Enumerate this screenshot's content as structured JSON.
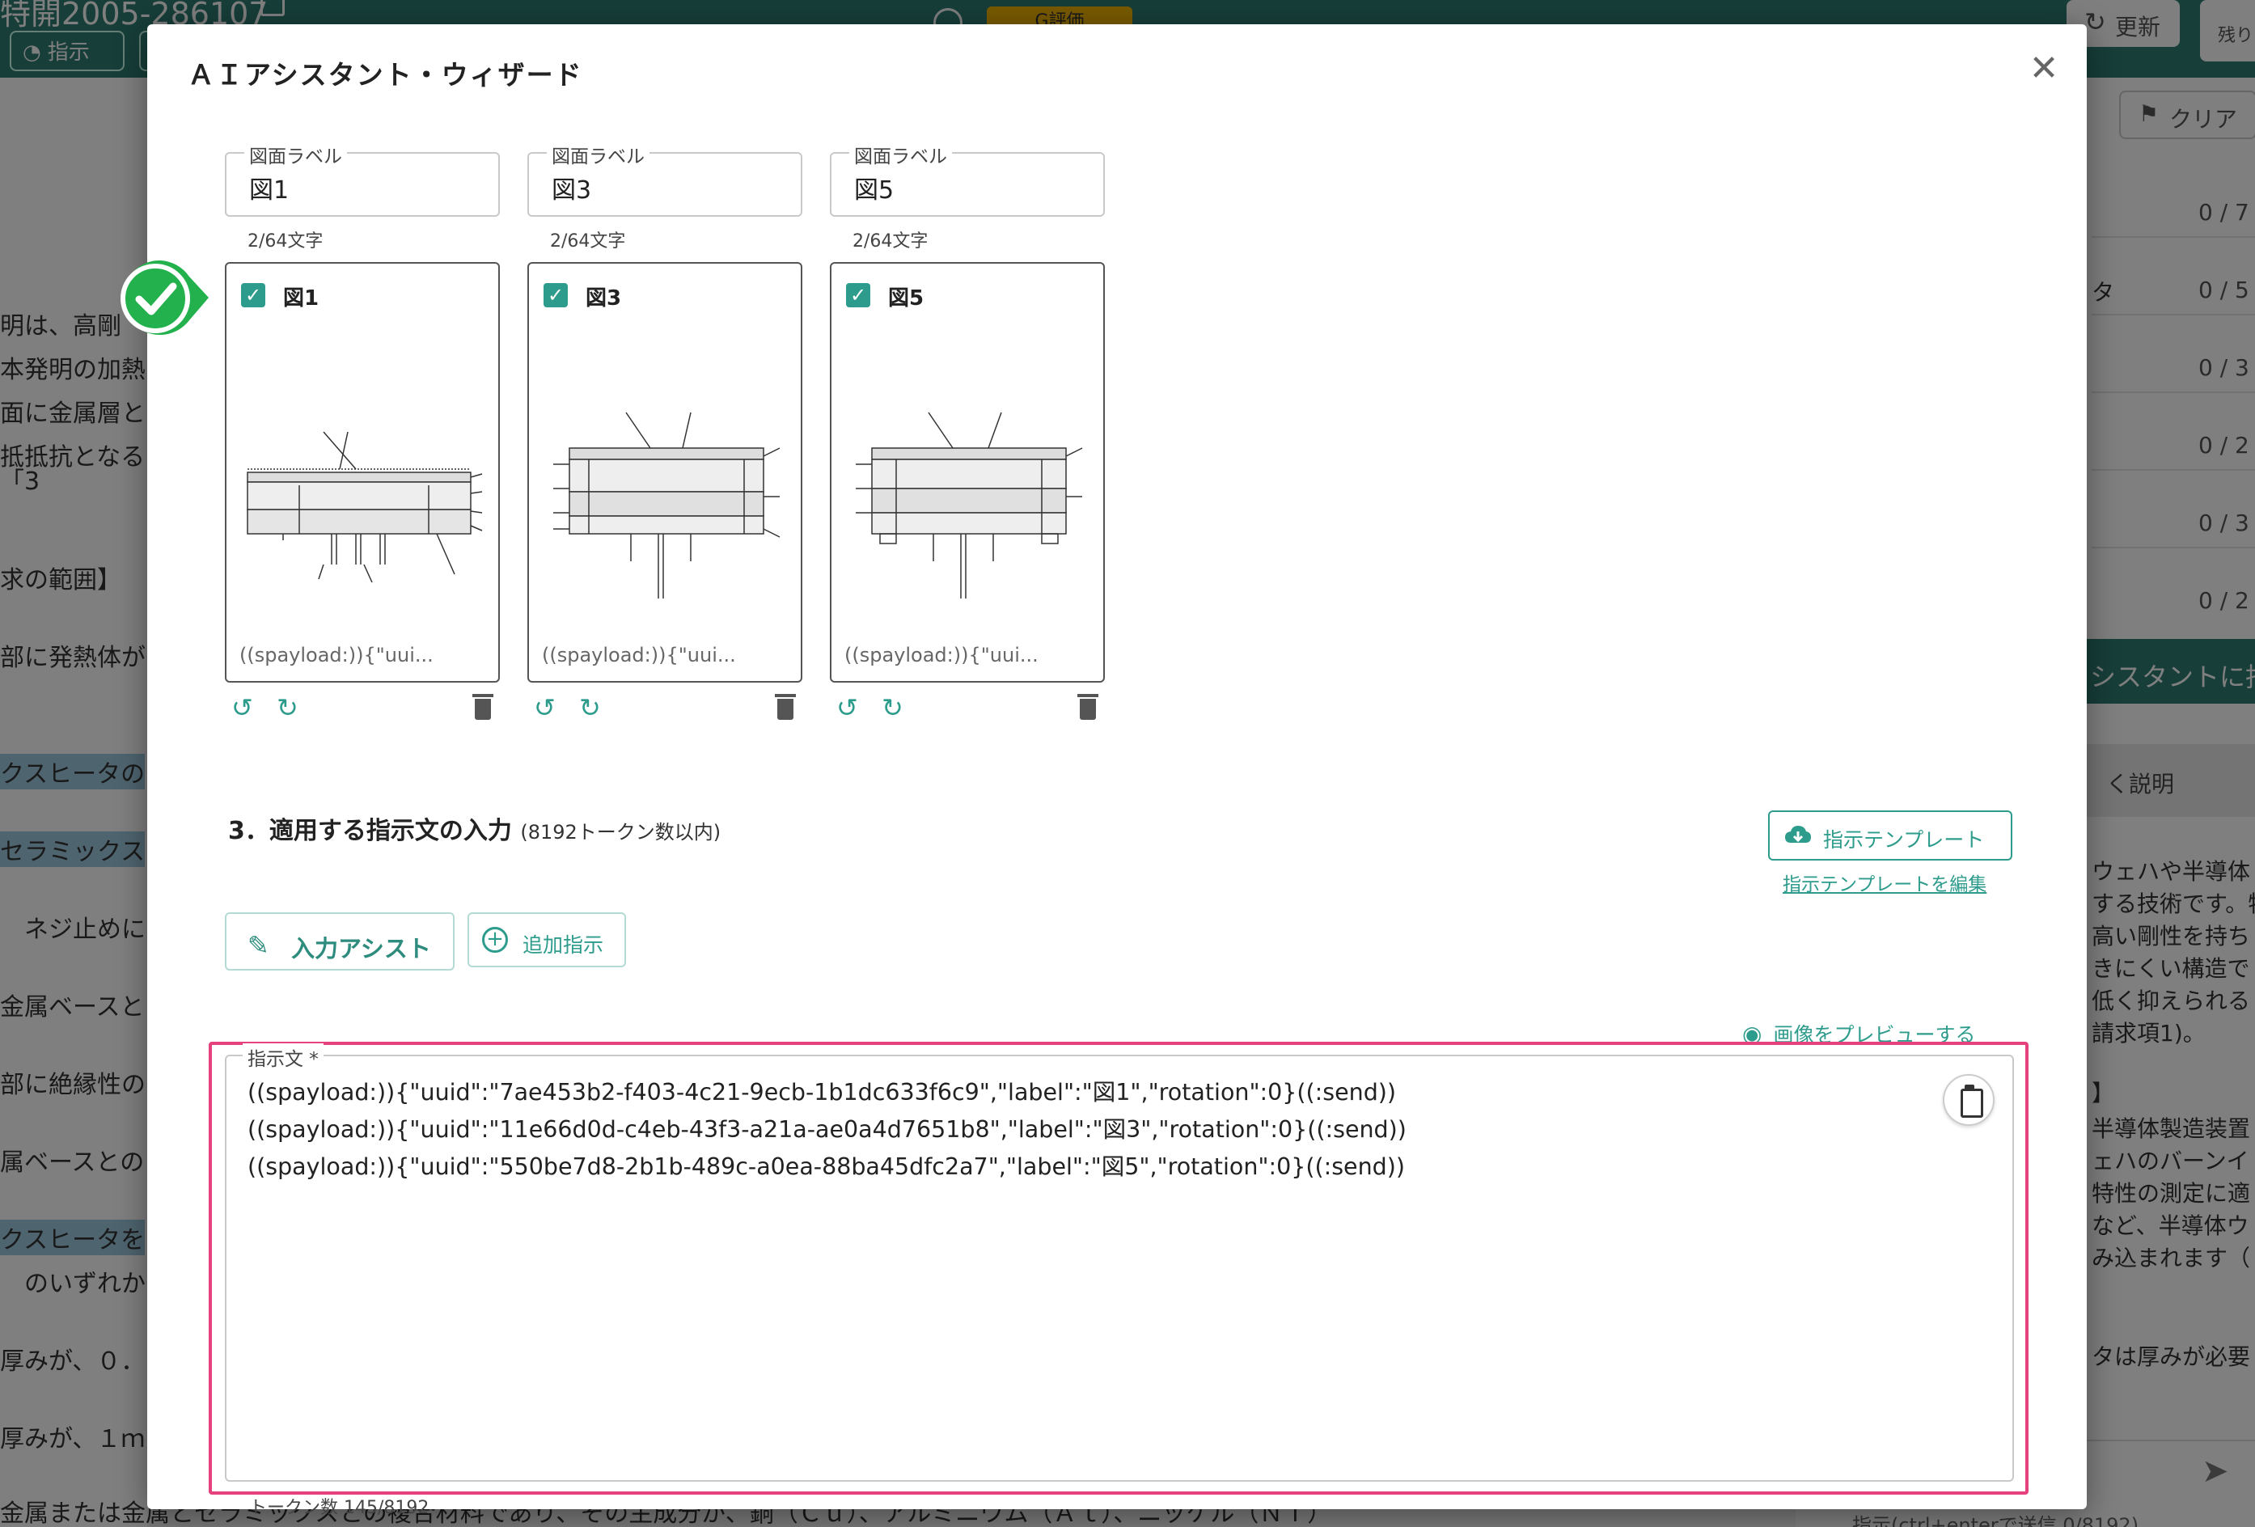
{
  "background": {
    "doc_title": "特開2005-286107",
    "nav_button": "指示",
    "grade_badge": "G評価",
    "update_button": "更新",
    "remaining_label": "残り",
    "clear_button": "クリア",
    "left_lines": [
      "明は、高剛",
      "本発明の加熱",
      "面に金属層と",
      "抵抵抗となる",
      "「3",
      "求の範囲】",
      "部に発熱体が",
      "クスヒータの",
      "セラミックス",
      "　ネジ止めに",
      "金属ベースと",
      "部に絶縁性の",
      "属ベースとの",
      "クスヒータを",
      "　のいずれか",
      "厚みが、０．",
      "厚みが、１ｍ"
    ],
    "right_counts": [
      "0 / 7",
      "0 / 5",
      "0 / 3",
      "0 / 2",
      "0 / 3",
      "0 / 2"
    ],
    "right_row_text": "タ",
    "right_green_button": "シスタントに指",
    "right_desc_header": "く説明",
    "right_text_lines": [
      "ウェハや半導体",
      "する技術です。特",
      "高い剛性を持ち",
      "きにくい構造で",
      "低く抑えられる",
      "請求項1)。",
      "】",
      "半導体製造装置",
      "ェハのバーンイ",
      "特性の測定に適",
      "など、半導体ウ",
      "み込まれます（",
      "タは厚みが必要"
    ],
    "bottom_input_hint": "指示(ctrl+enterで送信 0/8192)",
    "footer_text": "金属または金属とセラミックスとの複合材料であり、その主成分が、銅（Ｃｕ）、アルミニウム（Ａｌ）、ニッケル（Ｎｉ）"
  },
  "modal": {
    "title": "ＡＩアシスタント・ウィザード",
    "close_icon": "close-icon",
    "figures": [
      {
        "label_caption": "図面ラベル",
        "label_value": "図1",
        "char_count": "2/64文字",
        "checked": true,
        "name": "図1",
        "payload_preview": "((spayload:)){\"uui..."
      },
      {
        "label_caption": "図面ラベル",
        "label_value": "図3",
        "char_count": "2/64文字",
        "checked": true,
        "name": "図3",
        "payload_preview": "((spayload:)){\"uui..."
      },
      {
        "label_caption": "図面ラベル",
        "label_value": "図5",
        "char_count": "2/64文字",
        "checked": true,
        "name": "図5",
        "payload_preview": "((spayload:)){\"uui..."
      }
    ],
    "section3": {
      "title": "3．適用する指示文の入力",
      "subtitle": "(8192トークン数以内)",
      "template_button": "指示テンプレート",
      "template_edit_link": "指示テンプレートを編集",
      "assist_button": "入力アシスト",
      "add_instruction_button": "追加指示",
      "preview_link": "画像をプレビューする",
      "textarea_label": "指示文 *",
      "textarea_value": "((spayload:)){\"uuid\":\"7ae453b2-f403-4c21-9ecb-1b1dc633f6c9\",\"label\":\"図1\",\"rotation\":0}((:send))\n((spayload:)){\"uuid\":\"11e66d0d-c4eb-43f3-a21a-ae0a4d7651b8\",\"label\":\"図3\",\"rotation\":0}((:send))\n((spayload:)){\"uuid\":\"550be7d8-2b1b-489c-a0ea-88ba45dfc2a7\",\"label\":\"図5\",\"rotation\":0}((:send))",
      "token_count": "トークン数 145/8192"
    }
  },
  "colors": {
    "accent": "#2e9c8c",
    "header": "#2e7d73",
    "highlight_border": "#e5417d",
    "success_badge": "#22b14c"
  }
}
